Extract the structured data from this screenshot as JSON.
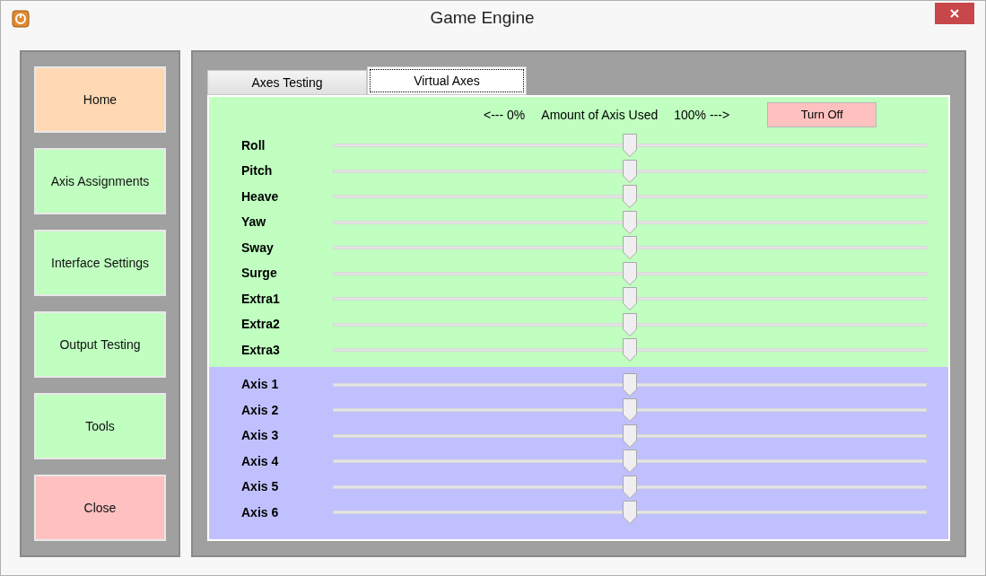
{
  "window": {
    "title": "Game Engine"
  },
  "sidebar": {
    "items": [
      {
        "label": "Home",
        "color": "#ffd8b4"
      },
      {
        "label": "Axis Assignments",
        "color": "#c0ffc0"
      },
      {
        "label": "Interface Settings",
        "color": "#c0ffc0"
      },
      {
        "label": "Output Testing",
        "color": "#c0ffc0"
      },
      {
        "label": "Tools",
        "color": "#c0ffc0"
      },
      {
        "label": "Close",
        "color": "#ffc0c0"
      }
    ]
  },
  "tabs": [
    {
      "label": "Axes Testing",
      "selected": false
    },
    {
      "label": "Virtual Axes",
      "selected": true
    }
  ],
  "header": {
    "min_label": "<--- 0%",
    "caption": "Amount of Axis Used",
    "max_label": "100% --->",
    "button": "Turn Off"
  },
  "groups": [
    {
      "color": "#c0ffc0",
      "sliders": [
        {
          "name": "Roll",
          "level": 0.5
        },
        {
          "name": "Pitch",
          "level": 0.5
        },
        {
          "name": "Heave",
          "level": 0.5
        },
        {
          "name": "Yaw",
          "level": 0.5
        },
        {
          "name": "Sway",
          "level": 0.5
        },
        {
          "name": "Surge",
          "level": 0.5
        },
        {
          "name": "Extra1",
          "level": 0.5
        },
        {
          "name": "Extra2",
          "level": 0.5
        },
        {
          "name": "Extra3",
          "level": 0.5
        }
      ]
    },
    {
      "color": "#c0c0ff",
      "sliders": [
        {
          "name": "Axis 1",
          "level": 0.5
        },
        {
          "name": "Axis 2",
          "level": 0.5
        },
        {
          "name": "Axis 3",
          "level": 0.5
        },
        {
          "name": "Axis 4",
          "level": 0.5
        },
        {
          "name": "Axis 5",
          "level": 0.5
        },
        {
          "name": "Axis 6",
          "level": 0.5
        }
      ]
    }
  ]
}
